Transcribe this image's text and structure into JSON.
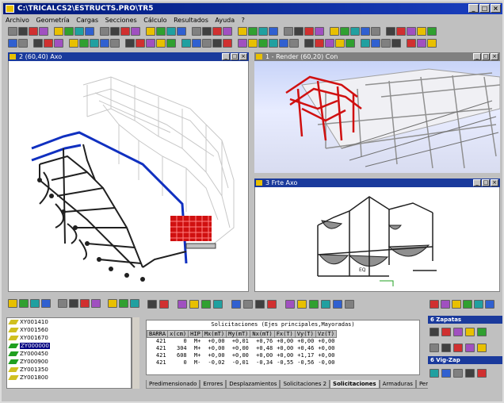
{
  "window": {
    "title": "C:\\TRICALCS2\\ESTRUCTS.PRO\\TR5"
  },
  "menu": [
    "Archivo",
    "Geometría",
    "Cargas",
    "Secciones",
    "Cálculo",
    "Resultados",
    "Ayuda",
    "?"
  ],
  "views": {
    "axo": {
      "title": "2  (60,40)  Axo"
    },
    "render": {
      "title": "1 - Render   (60,20)  Con"
    },
    "front": {
      "title": "3  Frte   Axo"
    }
  },
  "sections_list": {
    "items": [
      "XY001410",
      "XY001560",
      "XY001670",
      "ZY000000",
      "ZY000450",
      "ZY000900",
      "ZY001350",
      "ZY001800"
    ],
    "selected_index": 3
  },
  "results": {
    "title": "Solicitaciones (Ejes principales,Mayoradas)",
    "columns": [
      "BARRA",
      "x(cm)",
      "HIP",
      "Mx(mT)",
      "My(mT)",
      "Nx(mT)",
      "Fx(T)",
      "Vy(T)",
      "Vz(T)"
    ],
    "rows": [
      [
        "421",
        "0",
        "M+",
        "+0,00",
        "+0,01",
        "+0,76",
        "+0,00",
        "+0,00",
        "+0,00"
      ],
      [
        "421",
        "304",
        "M+",
        "+0,00",
        "+0,00",
        "+0,48",
        "+0,00",
        "+0,46",
        "+0,00"
      ],
      [
        "421",
        "608",
        "M+",
        "+0,00",
        "+0,00",
        "+0,00",
        "+0,00",
        "+1,17",
        "+0,00"
      ],
      [
        "421",
        "0",
        "M-",
        "-0,02",
        "-0,01",
        "-0,34",
        "-0,55",
        "-0,56",
        "-0,00"
      ]
    ],
    "tabs": [
      "Predimensionado",
      "Errores",
      "Desplazamientos",
      "Solicitaciones 2",
      "Solicitaciones",
      "Armaduras",
      "Peritaje Barras"
    ],
    "active_tab": "Solicitaciones"
  },
  "right_panels": {
    "zapatas": "6 Zapatas",
    "vigzap": "6 Vig-Zap"
  },
  "label_eq": "EQ",
  "colors": {
    "title_active": "#1a3a9c",
    "title_inactive": "#808080",
    "structure_red": "#d01010",
    "structure_blue": "#1030c0"
  }
}
